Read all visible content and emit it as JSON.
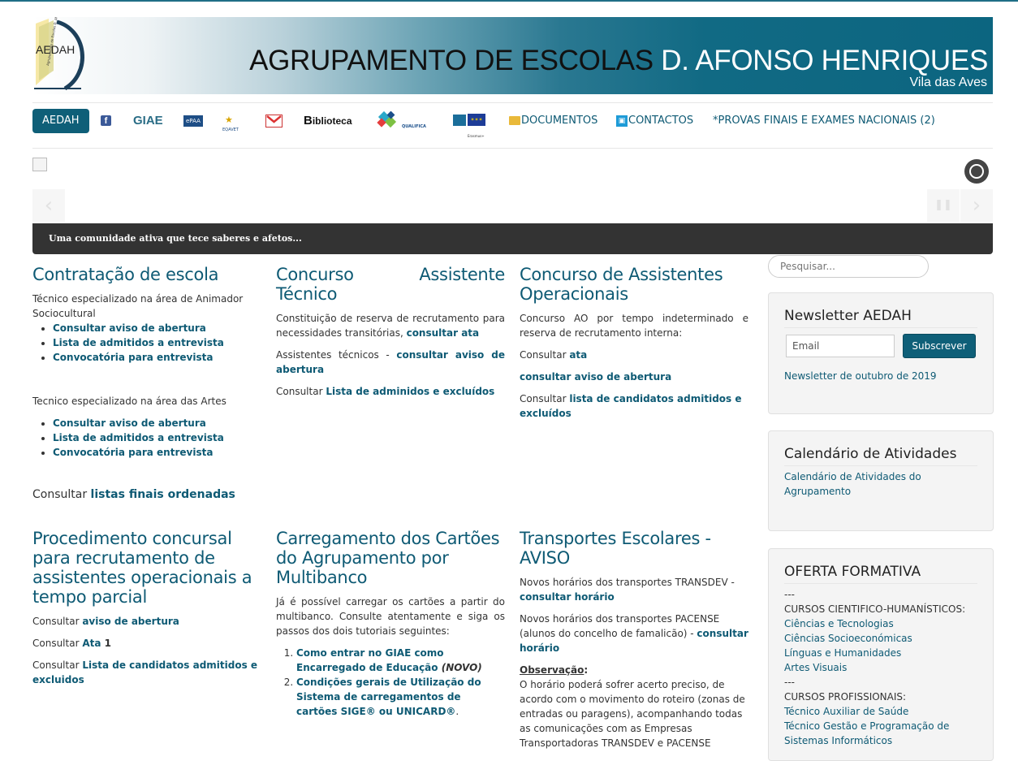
{
  "banner": {
    "logo_text": "AEDAH",
    "title_dark": "AGRUPAMENTO DE ESCOLAS",
    "title_light": "D. AFONSO HENRIQUES",
    "subtitle": "Vila das Aves"
  },
  "nav": {
    "home": "AEDAH",
    "giae": "GIAE",
    "epaa": "ePAA",
    "eqavet": "EQAVET",
    "biblioteca": "iblioteca",
    "biblioteca_b": "B",
    "qualifica": "QUALIFICA",
    "erasmus": "Erasmus+",
    "documentos": "DOCUMENTOS",
    "contactos": "CONTACTOS",
    "provas": "*PROVAS FINAIS E EXAMES NACIONAIS (2)"
  },
  "slider": {
    "caption": "Uma comunidade ativa que tece saberes e afetos...",
    "prev": "‹",
    "pause": "❚❚",
    "next": "›"
  },
  "articles": {
    "a1": {
      "title": "Contratação de escola",
      "intro1": "Técnico especializado na área de Animador Sociocultural",
      "list1": [
        "Consultar aviso de abertura",
        "Lista de admitidos a entrevista",
        "Convocatória para entrevista"
      ],
      "intro2": "Tecnico especializado na área das Artes",
      "list2": [
        "Consultar aviso de abertura",
        "Lista de admitidos a entrevista",
        "Convocatória para entrevista"
      ],
      "footer_prefix": "Consultar ",
      "footer_link": "listas finais ordenadas"
    },
    "a2": {
      "title": "Concurso Assistente Técnico",
      "p1_text": "Constituição de reserva de recrutamento para necessidades transitórias, ",
      "p1_link": "consultar ata",
      "p2_text": "Assistentes técnicos - ",
      "p2_link": "consultar aviso de abertura",
      "p3_text": "Consultar ",
      "p3_link": "Lista de adminidos e excluídos"
    },
    "a3": {
      "title": "Concurso de Assistentes Operacionais",
      "p1_text": "Concurso AO por tempo indeterminado e reserva de recrutamento interna:",
      "p2_text": "Consultar ",
      "p2_link": "ata",
      "p3_link": "consultar aviso de abertura",
      "p4_text": "Consultar ",
      "p4_link": "lista de candidatos admitidos e excluídos"
    },
    "a4": {
      "title": "Procedimento concursal para recrutamento de assistentes operacionais a tempo parcial",
      "p1_text": "Consultar ",
      "p1_link": "aviso de abertura",
      "p2_text": "Consultar ",
      "p2_link": "Ata",
      "p2_bold": " 1",
      "p3_text": " Consultar ",
      "p3_link": "Lista de candidatos admitidos e excluidos"
    },
    "a5": {
      "title": "Carregamento dos Cartões do Agrupamento por Multibanco",
      "p1": "Já é possível carregar os cartões a partir do multibanco. Consulte atentamente e siga os passos dos dois tutoriais seguintes:",
      "item1_link": "Como entrar no GIAE como Encarregado de Educação",
      "item1_tag": " (NOVO)",
      "item2_link": "Condições gerais de Utilização do Sistema de carregamentos de cartões SIGE® ou UNICARD®",
      "item2_end": "."
    },
    "a6": {
      "title": "Transportes Escolares - AVISO",
      "p1_text": "Novos horários dos transportes TRANSDEV - ",
      "p1_link": "consultar horário",
      "p2_text": "Novos horários dos transportes PACENSE (alunos do concelho de famalicão) - ",
      "p2_link": "consultar horário",
      "obs_label": "Observação",
      "obs_colon": ":",
      "p3": "O horário poderá sofrer acerto preciso, de acordo com o movimento do roteiro (zonas de entradas ou paragens), acompanhando todas as comunicações com as Empresas Transportadoras TRANSDEV e PACENSE"
    }
  },
  "sidebar": {
    "search_placeholder": "Pesquisar...",
    "newsletter": {
      "title": "Newsletter AEDAH",
      "email_placeholder": "Email",
      "button": "Subscrever",
      "link": "Newsletter de outubro de 2019"
    },
    "calendar": {
      "title": "Calendário de Atividades",
      "link": "Calendário de Atividades do Agrupamento"
    },
    "oferta": {
      "title": "OFERTA FORMATIVA",
      "sep1": "---",
      "group1": "CURSOS CIENTIFICO-HUMANÍSTICOS:",
      "courses1": [
        "Ciências e Tecnologias",
        "Ciências Socioeconómicas",
        "Línguas e Humanidades",
        "Artes Visuais"
      ],
      "sep2": "---",
      "group2": "CURSOS PROFISSIONAIS:",
      "courses2": [
        "Técnico Auxiliar de Saúde",
        "Técnico Gestão e Programação de Sistemas Informáticos"
      ]
    }
  },
  "colors": {
    "accent": "#0e5a74",
    "dark_bar": "#333333",
    "nav_home": "#0f5f78"
  }
}
